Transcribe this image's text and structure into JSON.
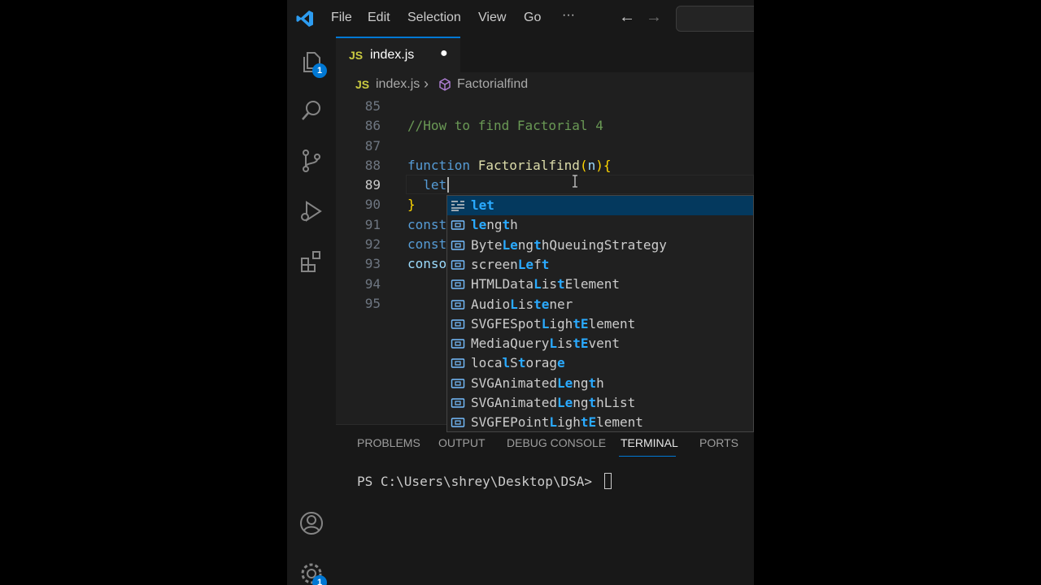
{
  "menu": {
    "file": "File",
    "edit": "Edit",
    "selection": "Selection",
    "view": "View",
    "go": "Go",
    "more": "···"
  },
  "nav": {
    "back": "←",
    "forward": "→"
  },
  "activity": {
    "explorer_badge": "1",
    "settings_badge": "1"
  },
  "tab": {
    "label": "index.js",
    "lang": "JS",
    "dirty": "●"
  },
  "breadcrumb": {
    "lang": "JS",
    "file": "index.js",
    "separator": "›",
    "symbol": "Factorialfind"
  },
  "editor": {
    "lines": [
      {
        "num": "85",
        "code": ""
      },
      {
        "num": "86",
        "code": "//How to find Factorial 4"
      },
      {
        "num": "87",
        "code": ""
      },
      {
        "num": "88",
        "kw": "function",
        "fn": "Factorialfind",
        "paren_open": "(",
        "param": "n",
        "paren_close": ")",
        "brace": "{"
      },
      {
        "num": "89",
        "code": "  let"
      },
      {
        "num": "90",
        "code": "}"
      },
      {
        "num": "91",
        "code": "const"
      },
      {
        "num": "92",
        "code": "const"
      },
      {
        "num": "93",
        "code": "conso"
      },
      {
        "num": "94",
        "code": ""
      },
      {
        "num": "95",
        "code": ""
      }
    ]
  },
  "suggest": {
    "items": [
      {
        "icon": "keyword",
        "pre": "",
        "match": "let",
        "post": ""
      },
      {
        "icon": "variable",
        "pre": "",
        "match": "le",
        "mid": "ng",
        "match2": "t",
        "post": "h"
      },
      {
        "icon": "variable",
        "pre": "Byte",
        "match": "Le",
        "mid": "ng",
        "match2": "t",
        "post": "hQueuingStrategy"
      },
      {
        "icon": "variable",
        "pre": "screen",
        "match": "Le",
        "mid": "f",
        "match2": "t",
        "post": ""
      },
      {
        "icon": "variable",
        "pre": "HTMLData",
        "match": "L",
        "mid": "is",
        "match2": "t",
        "post": "Element"
      },
      {
        "icon": "variable",
        "pre": "Audio",
        "match": "L",
        "mid": "is",
        "match2": "te",
        "post": "ner"
      },
      {
        "icon": "variable",
        "pre": "SVGFESpot",
        "match": "L",
        "mid": "igh",
        "match2": "tE",
        "post": "lement"
      },
      {
        "icon": "variable",
        "pre": "MediaQuery",
        "match": "L",
        "mid": "is",
        "match2": "tE",
        "post": "vent"
      },
      {
        "icon": "variable",
        "pre": "loca",
        "match": "l",
        "mid": "S",
        "match2": "t",
        "post": "orag",
        "match3": "e"
      },
      {
        "icon": "variable",
        "pre": "SVGAnimated",
        "match": "Le",
        "mid": "ng",
        "match2": "t",
        "post": "h"
      },
      {
        "icon": "variable",
        "pre": "SVGAnimated",
        "match": "Le",
        "mid": "ng",
        "match2": "t",
        "post": "hList"
      },
      {
        "icon": "variable",
        "pre": "SVGFEPoint",
        "match": "L",
        "mid": "igh",
        "match2": "tE",
        "post": "lement"
      }
    ]
  },
  "panel": {
    "tabs": [
      "PROBLEMS",
      "OUTPUT",
      "DEBUG CONSOLE",
      "TERMINAL",
      "PORTS"
    ],
    "terminal_prompt": "PS C:\\Users\\shrey\\Desktop\\DSA> "
  },
  "colors": {
    "accent": "#0078d4",
    "selection": "#04395e",
    "match": "#2aaaff"
  }
}
